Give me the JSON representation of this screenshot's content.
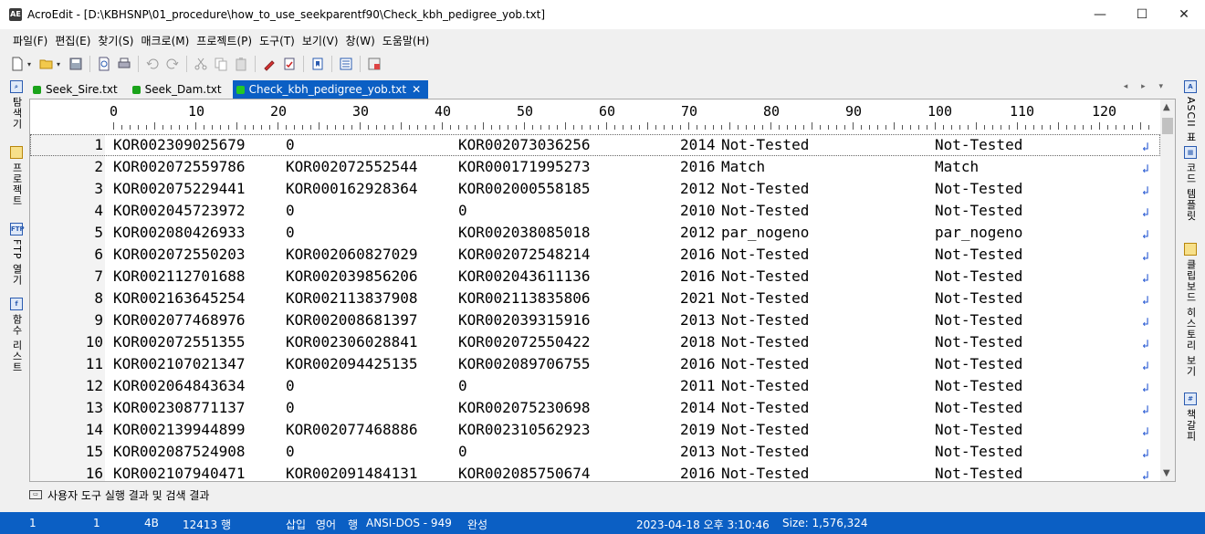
{
  "window": {
    "title": "AcroEdit - [D:\\KBHSNP\\01_procedure\\how_to_use_seekparentf90\\Check_kbh_pedigree_yob.txt]",
    "app_icon_text": "AE",
    "minimize": "—",
    "maximize": "☐",
    "close": "✕"
  },
  "menu": [
    "파일(F)",
    "편집(E)",
    "찾기(S)",
    "매크로(M)",
    "프로젝트(P)",
    "도구(T)",
    "보기(V)",
    "창(W)",
    "도움말(H)"
  ],
  "toolbar_icons": [
    "new-file-icon",
    "open-folder-icon",
    "save-icon",
    "print-preview-icon",
    "print-icon",
    "undo-icon",
    "redo-icon",
    "cut-icon",
    "copy-icon",
    "paste-icon",
    "highlighter-icon",
    "spell-icon",
    "bookmark-icon",
    "list-view-icon",
    "options-icon"
  ],
  "left_panel": [
    "탐색기",
    "프로젝트",
    "FTP 열기",
    "함수 리스트"
  ],
  "right_panel": [
    "ASCII 표",
    "코드 템플릿",
    "클립보드 히스토리 보기",
    "책갈피"
  ],
  "tabs": [
    {
      "label": "Seek_Sire.txt",
      "active": false
    },
    {
      "label": "Seek_Dam.txt",
      "active": false
    },
    {
      "label": "Check_kbh_pedigree_yob.txt",
      "active": true,
      "close": "✕"
    }
  ],
  "tab_nav": "◂ ▸ ▾",
  "ruler": {
    "labels": [
      "0",
      "10",
      "20",
      "30",
      "40",
      "50",
      "60",
      "70",
      "80",
      "90",
      "100",
      "110",
      "120"
    ]
  },
  "rows": [
    {
      "n": "1",
      "id": "KOR002309025679",
      "sire": "0",
      "dam": "KOR002073036256",
      "year": "2014",
      "s1": "Not-Tested",
      "s2": "Not-Tested"
    },
    {
      "n": "2",
      "id": "KOR002072559786",
      "sire": "KOR002072552544",
      "dam": "KOR000171995273",
      "year": "2016",
      "s1": "Match",
      "s2": "Match"
    },
    {
      "n": "3",
      "id": "KOR002075229441",
      "sire": "KOR000162928364",
      "dam": "KOR002000558185",
      "year": "2012",
      "s1": "Not-Tested",
      "s2": "Not-Tested"
    },
    {
      "n": "4",
      "id": "KOR002045723972",
      "sire": "0",
      "dam": "0",
      "year": "2010",
      "s1": "Not-Tested",
      "s2": "Not-Tested"
    },
    {
      "n": "5",
      "id": "KOR002080426933",
      "sire": "0",
      "dam": "KOR002038085018",
      "year": "2012",
      "s1": "par_nogeno",
      "s2": "par_nogeno"
    },
    {
      "n": "6",
      "id": "KOR002072550203",
      "sire": "KOR002060827029",
      "dam": "KOR002072548214",
      "year": "2016",
      "s1": "Not-Tested",
      "s2": "Not-Tested"
    },
    {
      "n": "7",
      "id": "KOR002112701688",
      "sire": "KOR002039856206",
      "dam": "KOR002043611136",
      "year": "2016",
      "s1": "Not-Tested",
      "s2": "Not-Tested"
    },
    {
      "n": "8",
      "id": "KOR002163645254",
      "sire": "KOR002113837908",
      "dam": "KOR002113835806",
      "year": "2021",
      "s1": "Not-Tested",
      "s2": "Not-Tested"
    },
    {
      "n": "9",
      "id": "KOR002077468976",
      "sire": "KOR002008681397",
      "dam": "KOR002039315916",
      "year": "2013",
      "s1": "Not-Tested",
      "s2": "Not-Tested"
    },
    {
      "n": "10",
      "id": "KOR002072551355",
      "sire": "KOR002306028841",
      "dam": "KOR002072550422",
      "year": "2018",
      "s1": "Not-Tested",
      "s2": "Not-Tested"
    },
    {
      "n": "11",
      "id": "KOR002107021347",
      "sire": "KOR002094425135",
      "dam": "KOR002089706755",
      "year": "2016",
      "s1": "Not-Tested",
      "s2": "Not-Tested"
    },
    {
      "n": "12",
      "id": "KOR002064843634",
      "sire": "0",
      "dam": "0",
      "year": "2011",
      "s1": "Not-Tested",
      "s2": "Not-Tested"
    },
    {
      "n": "13",
      "id": "KOR002308771137",
      "sire": "0",
      "dam": "KOR002075230698",
      "year": "2014",
      "s1": "Not-Tested",
      "s2": "Not-Tested"
    },
    {
      "n": "14",
      "id": "KOR002139944899",
      "sire": "KOR002077468886",
      "dam": "KOR002310562923",
      "year": "2019",
      "s1": "Not-Tested",
      "s2": "Not-Tested"
    },
    {
      "n": "15",
      "id": "KOR002087524908",
      "sire": "0",
      "dam": "0",
      "year": "2013",
      "s1": "Not-Tested",
      "s2": "Not-Tested"
    },
    {
      "n": "16",
      "id": "KOR002107940471",
      "sire": "KOR002091484131",
      "dam": "KOR002085750674",
      "year": "2016",
      "s1": "Not-Tested",
      "s2": "Not-Tested"
    }
  ],
  "eol_mark": "↲",
  "output_bar": {
    "label": "사용자 도구 실행 결과 및 검색 결과",
    "icon": "output-panel-icon"
  },
  "status": {
    "line": "1",
    "col": "1",
    "bytes": "4B",
    "total_lines": "12413 행",
    "mode_insert": "삽입",
    "mode_lang": "영어",
    "mode_line": "행",
    "encoding": "ANSI-DOS - 949",
    "state": "완성",
    "datetime": "2023-04-18 오후 3:10:46",
    "size": "Size: 1,576,324"
  },
  "colors": {
    "accent": "#0b5fc4",
    "eol": "#1a4fd0",
    "tab_dot": "#1aa31a"
  }
}
